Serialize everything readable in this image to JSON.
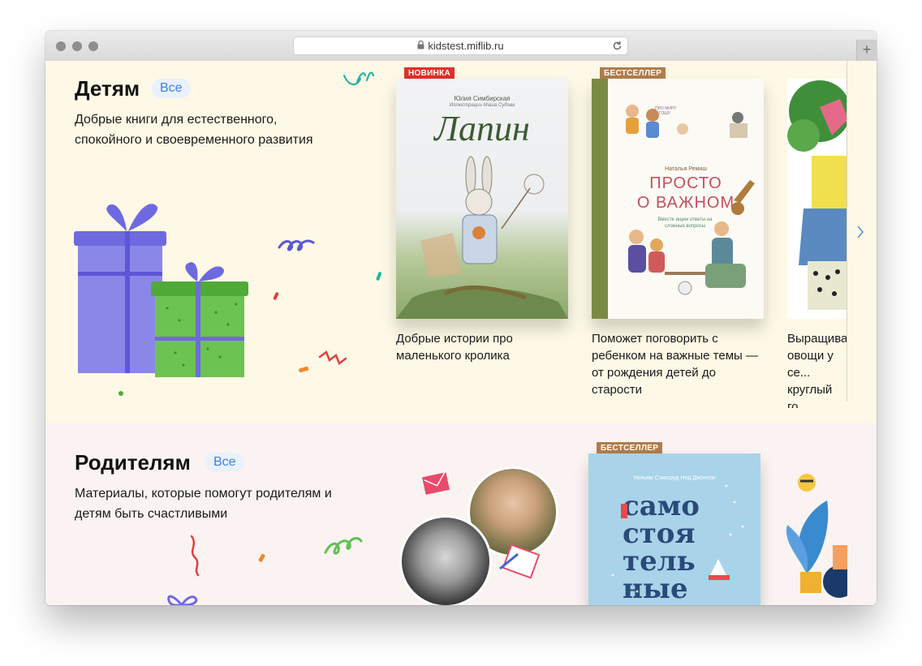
{
  "browser": {
    "url": "kidstest.miflib.ru",
    "new_tab_icon": "+",
    "reload_icon": "reload-icon",
    "lock_icon": "lock-icon"
  },
  "kids": {
    "title": "Детям",
    "all_label": "Все",
    "description": "Добрые книги для естественного, спокойного и своевременного развития",
    "books": [
      {
        "badge": "НОВИНКА",
        "badge_color": "#e0302a",
        "cover_author": "Юлия Симбирская",
        "cover_subtitle": "Иллюстрации Маша Судова",
        "cover_title": "Лапин",
        "caption": "Добрые истории про маленького кролика"
      },
      {
        "badge": "БЕСТСЕЛЛЕР",
        "badge_color": "#b07d4a",
        "cover_series": "ПРО МИРУ И ГОШУ",
        "cover_author": "Наталья Ремиш",
        "cover_title_1": "ПРОСТО",
        "cover_title_2": "О ВАЖНОМ",
        "cover_subtitle": "Вместе ищем ответы на сложные вопросы",
        "caption": "Поможет поговорить с ребенком на важные темы — от рождения детей до старости"
      },
      {
        "caption": "Выращива... овощи у се... круглый го..."
      }
    ]
  },
  "parents": {
    "title": "Родителям",
    "all_label": "Все",
    "description": "Материалы, которые помогут родителям и детям быть счастливыми",
    "books": [
      {
        "badge": "БЕСТСЕЛЛЕР",
        "badge_color": "#b07d4a",
        "cover_author": "Уильям Стиксруд Нед Джонсон",
        "cover_title": [
          "само",
          "стоя",
          "тель",
          "ные"
        ]
      }
    ]
  }
}
